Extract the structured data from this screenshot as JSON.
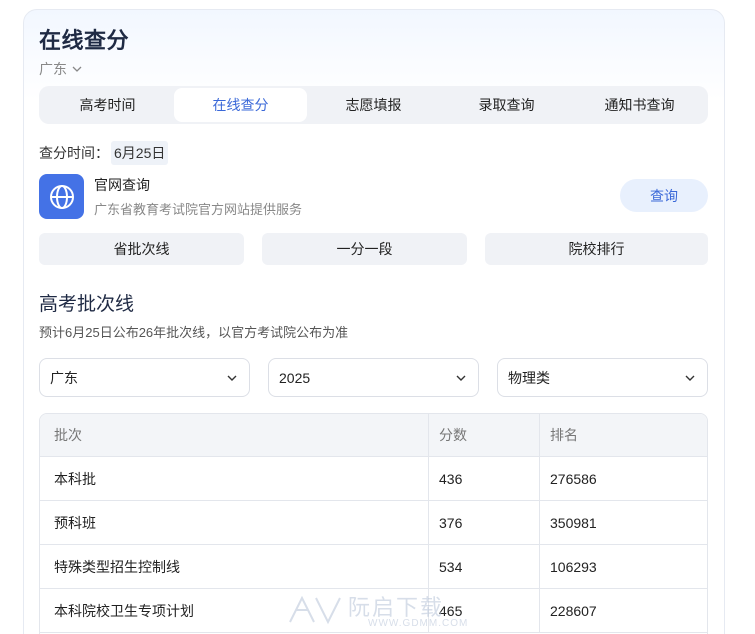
{
  "header": {
    "title": "在线查分",
    "region": "广东"
  },
  "tabs": [
    {
      "label": "高考时间",
      "active": false
    },
    {
      "label": "在线查分",
      "active": true
    },
    {
      "label": "志愿填报",
      "active": false
    },
    {
      "label": "录取查询",
      "active": false
    },
    {
      "label": "通知书查询",
      "active": false
    }
  ],
  "query_time": {
    "label": "查分时间：",
    "value": "6月25日"
  },
  "official": {
    "icon": "globe-icon",
    "title": "官网查询",
    "subtitle": "广东省教育考试院官方网站提供服务",
    "button": "查询"
  },
  "quick_links": [
    "省批次线",
    "一分一段",
    "院校排行"
  ],
  "batch_section": {
    "title": "高考批次线",
    "note": "预计6月25日公布26年批次线，以官方考试院公布为准",
    "filters": [
      {
        "value": "广东"
      },
      {
        "value": "2025"
      },
      {
        "value": "物理类"
      }
    ],
    "table": {
      "headers": [
        "批次",
        "分数",
        "排名"
      ],
      "rows": [
        [
          "本科批",
          "436",
          "276586"
        ],
        [
          "预科班",
          "376",
          "350981"
        ],
        [
          "特殊类型招生控制线",
          "534",
          "106293"
        ],
        [
          "本科院校卫生专项计划",
          "465",
          "228607"
        ]
      ]
    }
  },
  "watermark": {
    "text": "阮启下载",
    "url": "WWW.GDMM.COM"
  },
  "colors": {
    "accent": "#3a68d8",
    "icon_bg": "#4472e6",
    "button_bg": "#e8f0fd"
  }
}
